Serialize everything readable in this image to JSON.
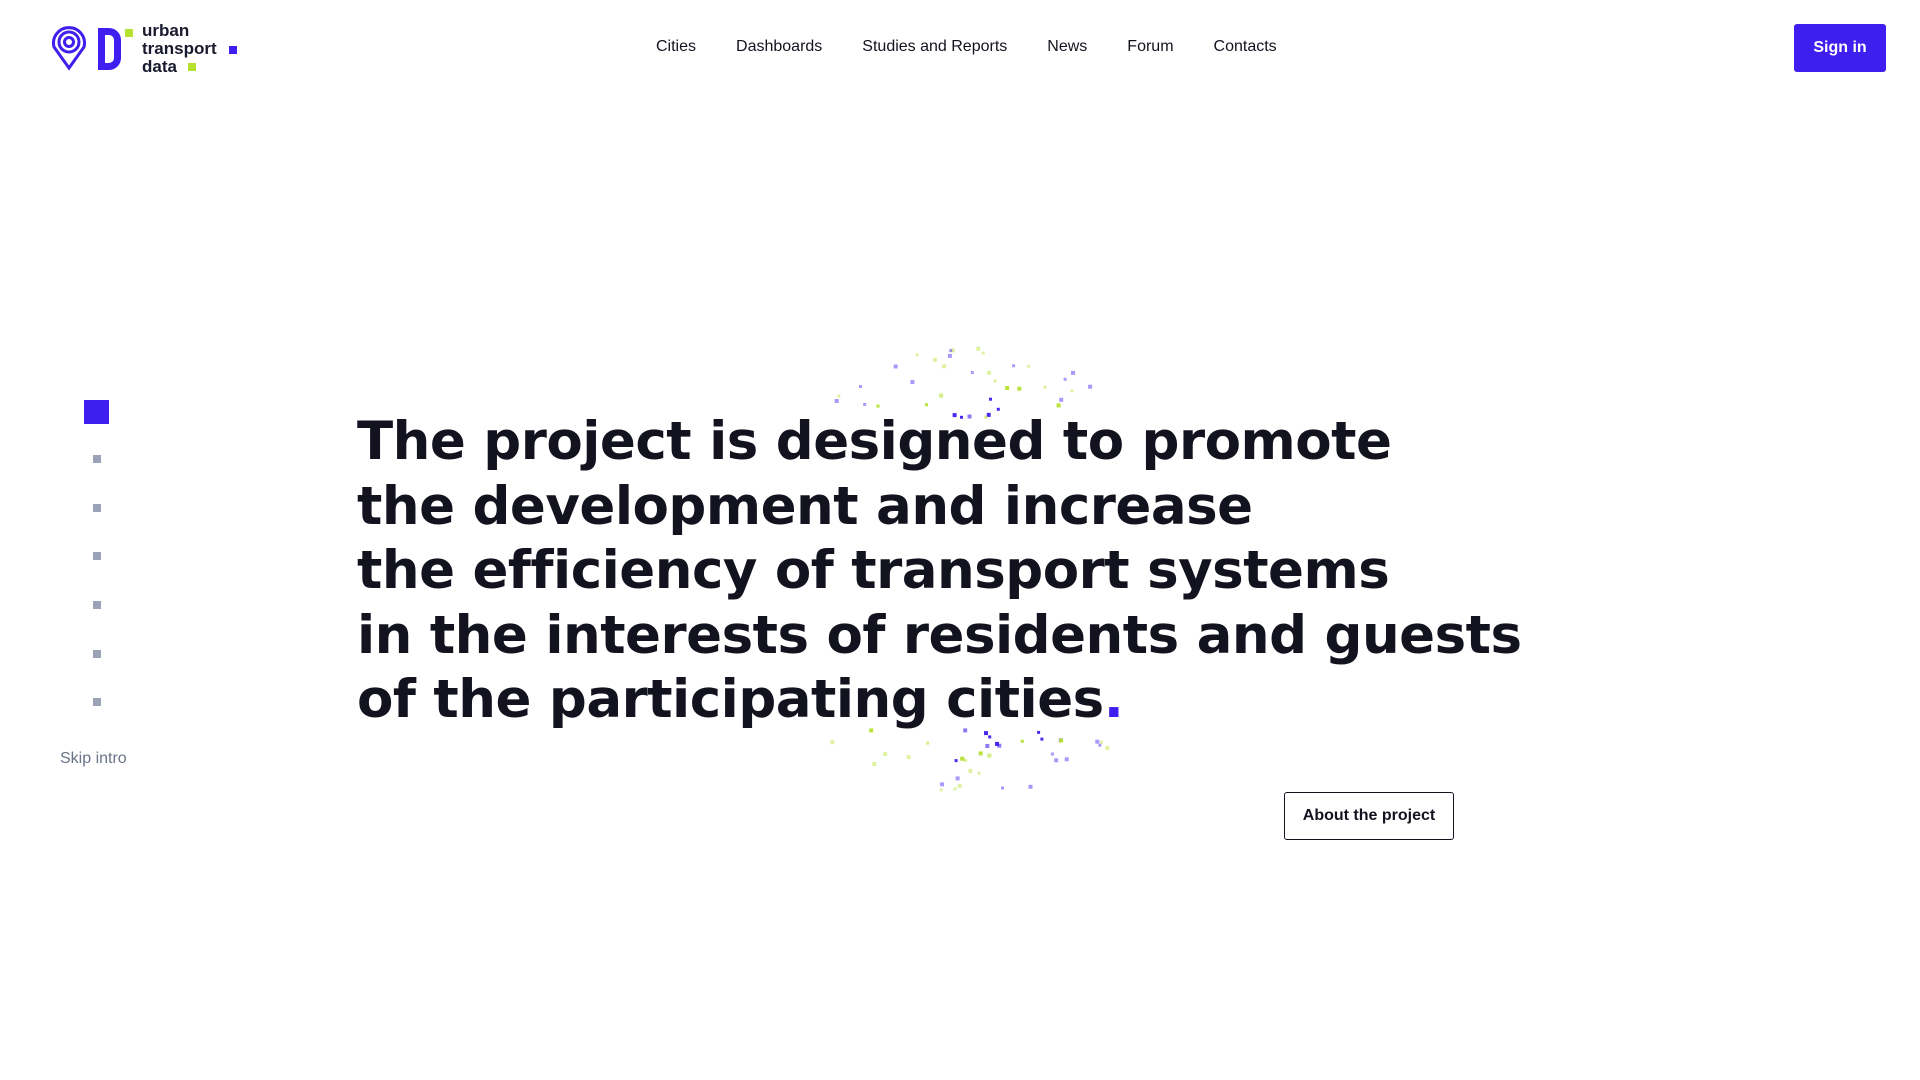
{
  "brand": {
    "logo_lines": [
      "urban",
      "transport",
      "data"
    ],
    "primary_color": "#3f1ff0",
    "secondary_color": "#b6e22e"
  },
  "nav": {
    "items": [
      "Cities",
      "Dashboards",
      "Studies and Reports",
      "News",
      "Forum",
      "Contacts"
    ]
  },
  "header": {
    "sign_in_label": "Sign in"
  },
  "pager": {
    "total": 7,
    "active": 1,
    "skip_label": "Skip intro"
  },
  "hero": {
    "lines": [
      "The project is designed to promote",
      "the development and increase",
      "the efficiency of transport systems",
      "in the interests of residents and guests",
      "of the participating cities"
    ],
    "end_mark": ".",
    "about_label": "About the project"
  }
}
